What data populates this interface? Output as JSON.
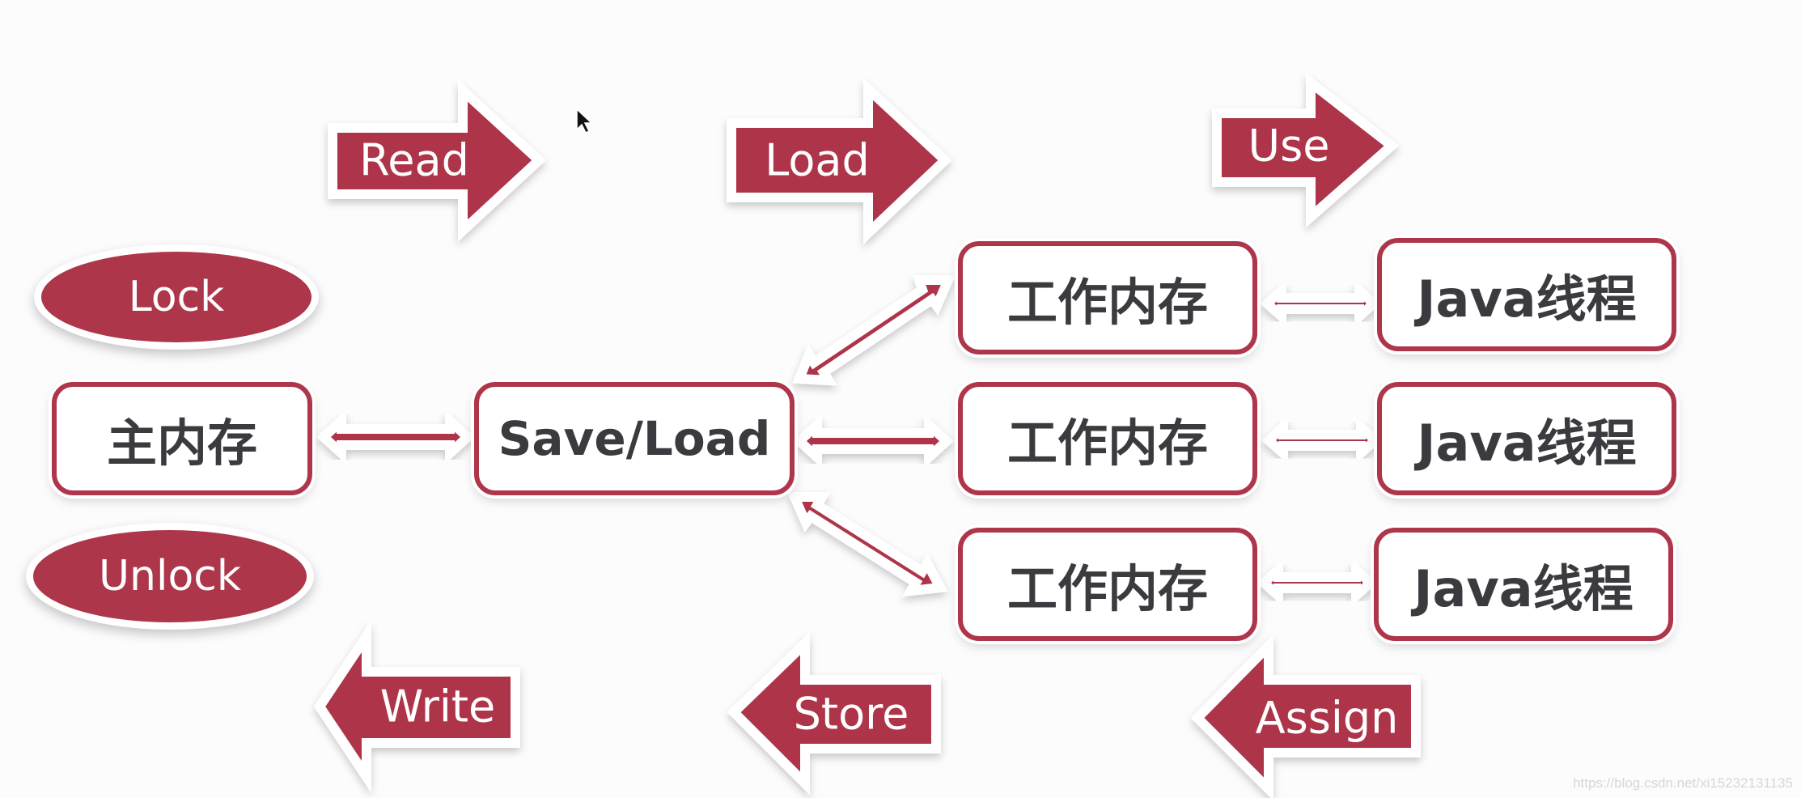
{
  "colors": {
    "accent": "#ae364a",
    "box_text": "#3b3a3e",
    "background": "#fdfcfd"
  },
  "operations": {
    "read": "Read",
    "load": "Load",
    "use": "Use",
    "write": "Write",
    "store": "Store",
    "assign": "Assign",
    "lock": "Lock",
    "unlock": "Unlock"
  },
  "nodes": {
    "main_memory": "主内存",
    "save_load": "Save/Load",
    "working_memory": [
      "工作内存",
      "工作内存",
      "工作内存"
    ],
    "java_thread": [
      "Java线程",
      "Java线程",
      "Java线程"
    ]
  },
  "watermark": "https://blog.csdn.net/xi15232131135"
}
